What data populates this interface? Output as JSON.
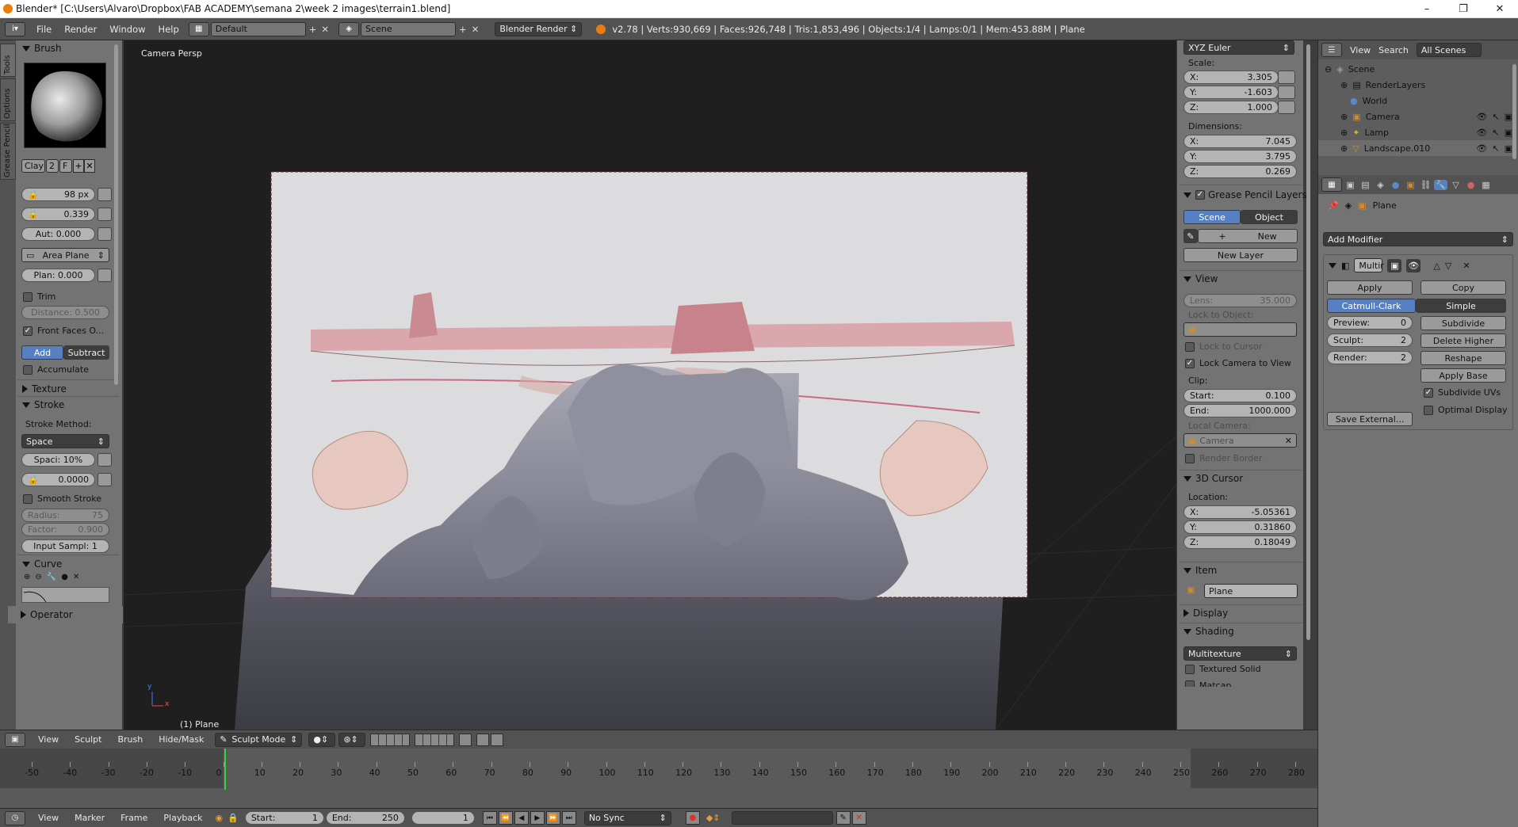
{
  "window": {
    "title": "Blender* [C:\\Users\\Alvaro\\Dropbox\\FAB ACADEMY\\semana 2\\week 2 images\\terrain1.blend]"
  },
  "menu": {
    "items": [
      "File",
      "Render",
      "Window",
      "Help"
    ],
    "layout": "Default",
    "scene": "Scene",
    "engine": "Blender Render",
    "stats": "v2.78 | Verts:930,669 | Faces:926,748 | Tris:1,853,496 | Objects:1/4 | Lamps:0/1 | Mem:453.88M | Plane"
  },
  "side_tabs": [
    "Tools",
    "Options",
    "Grease Pencil"
  ],
  "tools": {
    "brush_header": "Brush",
    "brush_name": "Clay",
    "brush_users": "2",
    "brush_fake": "F",
    "radius": "98 px",
    "strength": "0.339",
    "autosmooth": "Aut: 0.000",
    "sculpt_plane": "Area Plane",
    "plane_offset": "Plan: 0.000",
    "trim": "Trim",
    "trim_distance": "Distance: 0.500",
    "front_faces": "Front Faces O...",
    "add": "Add",
    "subtract": "Subtract",
    "accumulate": "Accumulate",
    "texture": "Texture",
    "stroke": "Stroke",
    "stroke_method_label": "Stroke Method:",
    "stroke_method": "Space",
    "spacing": "Spaci: 10%",
    "jitter": "0.0000",
    "smooth_stroke": "Smooth Stroke",
    "smooth_radius_label": "Radius:",
    "smooth_radius": "75",
    "smooth_factor_label": "Factor:",
    "smooth_factor": "0.900",
    "input_samples": "Input Sampl:  1",
    "curve": "Curve",
    "operator": "Operator"
  },
  "viewport": {
    "label": "Camera Persp",
    "object": "(1) Plane",
    "axis_x": "x",
    "axis_y": "y"
  },
  "npanel": {
    "rot_mode": "XYZ Euler",
    "scale_label": "Scale:",
    "scale": [
      {
        "k": "X:",
        "v": "3.305"
      },
      {
        "k": "Y:",
        "v": "-1.603"
      },
      {
        "k": "Z:",
        "v": "1.000"
      }
    ],
    "dim_label": "Dimensions:",
    "dims": [
      {
        "k": "X:",
        "v": "7.045"
      },
      {
        "k": "Y:",
        "v": "3.795"
      },
      {
        "k": "Z:",
        "v": "0.269"
      }
    ],
    "gp_layers": "Grease Pencil Layers",
    "gp_scene": "Scene",
    "gp_object": "Object",
    "gp_new": "New",
    "gp_new_layer": "New Layer",
    "view": "View",
    "lens_label": "Lens:",
    "lens": "35.000",
    "lock_object": "Lock to Object:",
    "lock_cursor": "Lock to Cursor",
    "lock_camera": "Lock Camera to View",
    "clip": "Clip:",
    "clip_start_label": "Start:",
    "clip_start": "0.100",
    "clip_end_label": "End:",
    "clip_end": "1000.000",
    "local_camera": "Local Camera:",
    "local_camera_value": "Camera",
    "render_border": "Render Border",
    "cursor": "3D Cursor",
    "location": "Location:",
    "cursor_loc": [
      {
        "k": "X:",
        "v": "-5.05361"
      },
      {
        "k": "Y:",
        "v": "0.31860"
      },
      {
        "k": "Z:",
        "v": "0.18049"
      }
    ],
    "item": "Item",
    "item_name": "Plane",
    "display": "Display",
    "shading": "Shading",
    "shading_mode": "Multitexture",
    "textured_solid": "Textured Solid",
    "matcap": "Matcap"
  },
  "outliner": {
    "view": "View",
    "search": "Search",
    "filter": "All Scenes",
    "items": [
      {
        "name": "Scene",
        "indent": 0
      },
      {
        "name": "RenderLayers",
        "indent": 1
      },
      {
        "name": "World",
        "indent": 1
      },
      {
        "name": "Camera",
        "indent": 1
      },
      {
        "name": "Lamp",
        "indent": 1
      },
      {
        "name": "Landscape.010",
        "indent": 1
      }
    ]
  },
  "props": {
    "breadcrumb": "Plane",
    "add_modifier": "Add Modifier",
    "mod_name": "Multir",
    "apply": "Apply",
    "copy": "Copy",
    "catmull": "Catmull-Clark",
    "simple": "Simple",
    "preview_label": "Preview:",
    "preview": "0",
    "sculpt_label": "Sculpt:",
    "sculpt": "2",
    "render_label": "Render:",
    "render": "2",
    "subdivide": "Subdivide",
    "delete_higher": "Delete Higher",
    "reshape": "Reshape",
    "apply_base": "Apply Base",
    "subdivide_uvs": "Subdivide UVs",
    "optimal_display": "Optimal Display",
    "save_external": "Save External..."
  },
  "view3d_header": {
    "items": [
      "View",
      "Sculpt",
      "Brush",
      "Hide/Mask"
    ],
    "mode": "Sculpt Mode"
  },
  "timeline": {
    "ticks": [
      -50,
      -40,
      -30,
      -20,
      -10,
      0,
      10,
      20,
      30,
      40,
      50,
      60,
      70,
      80,
      90,
      100,
      110,
      120,
      130,
      140,
      150,
      160,
      170,
      180,
      190,
      200,
      210,
      220,
      230,
      240,
      250,
      260,
      270,
      280
    ],
    "current": 1,
    "start": 1,
    "end": 250
  },
  "timeline_header": {
    "items": [
      "View",
      "Marker",
      "Frame",
      "Playback"
    ],
    "start_label": "Start:",
    "start": "1",
    "end_label": "End:",
    "end": "250",
    "frame": "1",
    "sync": "No Sync"
  }
}
